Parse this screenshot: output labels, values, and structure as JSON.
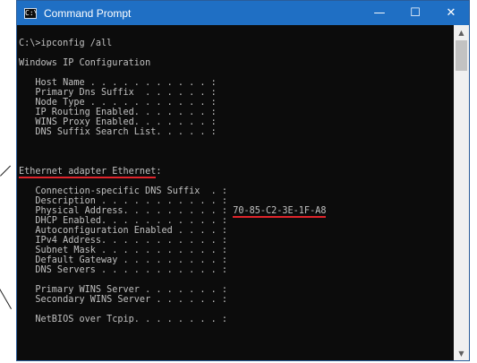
{
  "window": {
    "title": "Command Prompt",
    "app_icon_glyph": "C:\\",
    "controls": {
      "minimize": "—",
      "maximize": "☐",
      "close": "✕"
    }
  },
  "console": {
    "prompt": "C:\\>ipconfig /all",
    "heading": "Windows IP Configuration",
    "host_name": "   Host Name . . . . . . . . . . . :",
    "primary_dns_suffix": "   Primary Dns Suffix  . . . . . . :",
    "node_type": "   Node Type . . . . . . . . . . . :",
    "ip_routing": "   IP Routing Enabled. . . . . . . :",
    "wins_proxy": "   WINS Proxy Enabled. . . . . . . :",
    "dns_suffix_search": "   DNS Suffix Search List. . . . . :",
    "adapter_heading": "Ethernet adapter Ethernet",
    "adapter_colon": ":",
    "conn_dns_suffix": "   Connection-specific DNS Suffix  . :",
    "description": "   Description . . . . . . . . . . . :",
    "physical_address_label": "   Physical Address. . . . . . . . . : ",
    "physical_address_value": "70-85-C2-3E-1F-A8",
    "dhcp_enabled": "   DHCP Enabled. . . . . . . . . . . :",
    "autoconfig": "   Autoconfiguration Enabled . . . . :",
    "ipv4": "   IPv4 Address. . . . . . . . . . . :",
    "subnet_mask": "   Subnet Mask . . . . . . . . . . . :",
    "default_gateway": "   Default Gateway . . . . . . . . . :",
    "dns_servers": "   DNS Servers . . . . . . . . . . . :",
    "primary_wins": "   Primary WINS Server . . . . . . . :",
    "secondary_wins": "   Secondary WINS Server . . . . . . :",
    "netbios": "   NetBIOS over Tcpip. . . . . . . . :"
  },
  "scrollbar": {
    "up_icon": "▲",
    "down_icon": "▼"
  },
  "colors": {
    "titlebar": "#1f6fc4",
    "console_bg": "#0c0c0c",
    "console_text": "#c0c0c0",
    "underline": "#e0242b"
  }
}
